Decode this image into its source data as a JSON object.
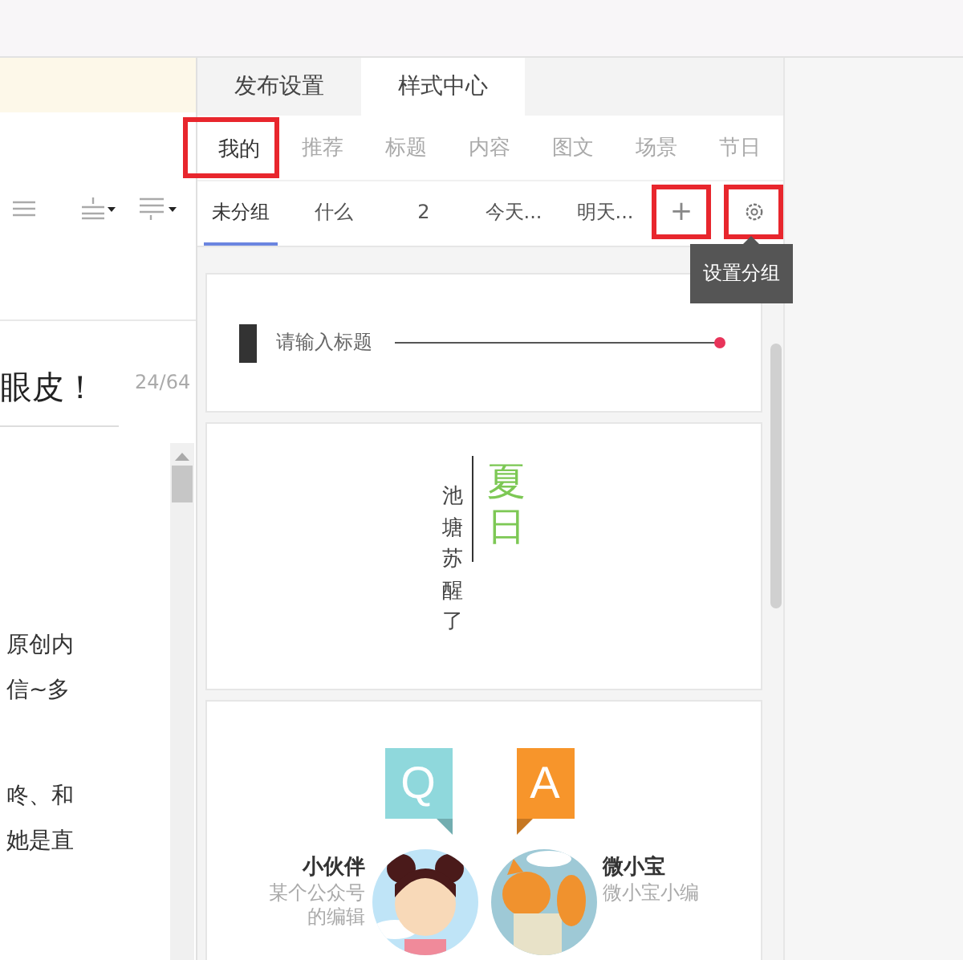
{
  "editor": {
    "title": "眼皮！",
    "counter": "24/64",
    "body_lines": [
      "原创内",
      "信~多",
      "咚、和",
      "她是直"
    ]
  },
  "panel": {
    "tabs": [
      {
        "label": "发布设置",
        "selected": false
      },
      {
        "label": "样式中心",
        "selected": true
      }
    ],
    "categories": [
      {
        "label": "我的",
        "selected": true,
        "highlighted": true
      },
      {
        "label": "推荐",
        "selected": false,
        "highlighted": false
      },
      {
        "label": "标题",
        "selected": false,
        "highlighted": false
      },
      {
        "label": "内容",
        "selected": false,
        "highlighted": false
      },
      {
        "label": "图文",
        "selected": false,
        "highlighted": false
      },
      {
        "label": "场景",
        "selected": false,
        "highlighted": false
      },
      {
        "label": "节日",
        "selected": false,
        "highlighted": false
      }
    ],
    "groups": [
      {
        "label": "未分组",
        "selected": true
      },
      {
        "label": "什么",
        "selected": false
      },
      {
        "label": "2",
        "selected": false
      },
      {
        "label": "今天...",
        "selected": false
      },
      {
        "label": "明天...",
        "selected": false
      }
    ],
    "add_button": {
      "label": "+",
      "highlighted": true
    },
    "settings_button": {
      "highlighted": true
    },
    "tooltip": "设置分组",
    "styles": [
      {
        "kind": "title",
        "text": "请输入标题"
      },
      {
        "kind": "vertical",
        "subtitle": "池塘苏醒了",
        "title": "夏日"
      },
      {
        "kind": "qa",
        "people": [
          {
            "badge": "Q",
            "name": "小伙伴",
            "description": "某个公众号的编辑",
            "color": "#8fd8dc"
          },
          {
            "badge": "A",
            "name": "微小宝",
            "description": "微小宝小编",
            "color": "#f7952b"
          }
        ]
      }
    ]
  }
}
